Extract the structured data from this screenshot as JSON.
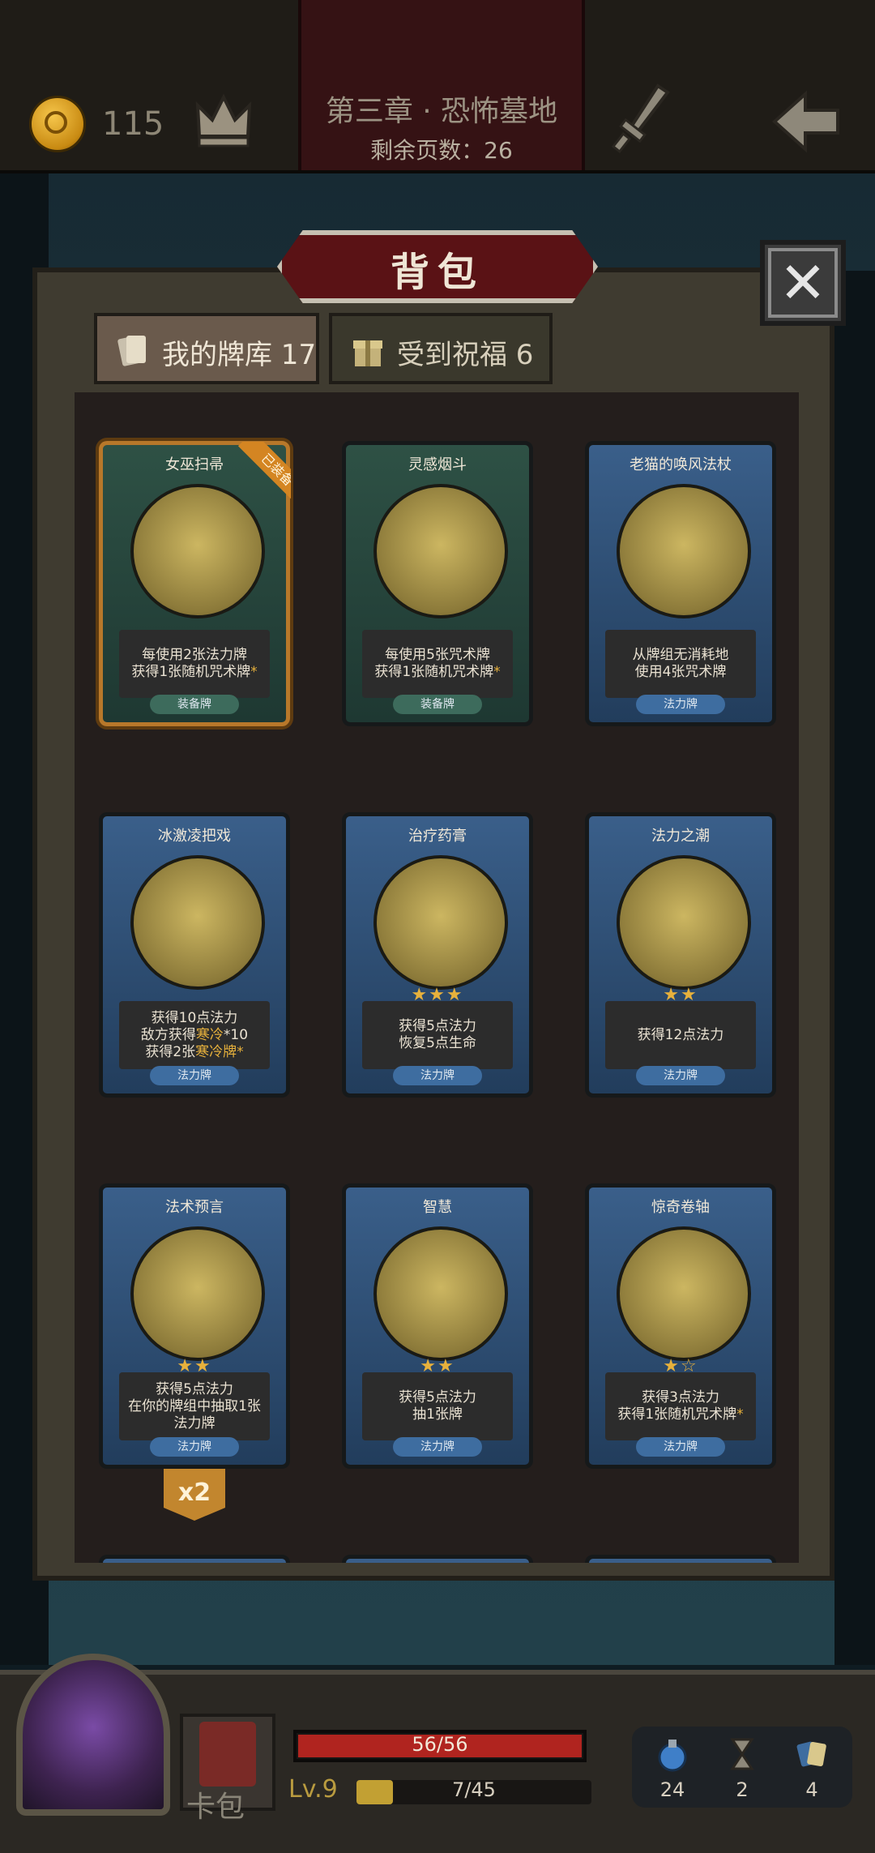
{
  "header": {
    "coins": "115",
    "chapter_title": "第三章 · 恐怖墓地",
    "pages_left": "剩余页数：26"
  },
  "dialog": {
    "title": "背包",
    "tabs": [
      {
        "label": "我的牌库 17"
      },
      {
        "label": "受到祝福 6"
      }
    ]
  },
  "cards": [
    {
      "name": "女巫扫帚",
      "desc1": "每使用2张法力牌",
      "desc2": "获得1张随机咒术牌",
      "desc2_mark": "*",
      "type": "装备牌",
      "badge": "已装备",
      "stars": ""
    },
    {
      "name": "灵感烟斗",
      "desc1": "每使用5张咒术牌",
      "desc2": "获得1张随机咒术牌",
      "desc2_mark": "*",
      "type": "装备牌",
      "stars": ""
    },
    {
      "name": "老猫的唤风法杖",
      "desc1": "从牌组无消耗地",
      "desc2": "使用4张咒术牌",
      "type": "法力牌",
      "stars": ""
    },
    {
      "name": "冰激凌把戏",
      "desc1": "获得10点法力",
      "desc2a": "敌方获得",
      "desc2b": "寒冷",
      "desc2c": "*10",
      "desc3a": "获得2张",
      "desc3b": "寒冷牌",
      "desc3c": "*",
      "type": "法力牌",
      "stars": ""
    },
    {
      "name": "治疗药膏",
      "desc1": "获得5点法力",
      "desc2": "恢复5点生命",
      "type": "法力牌",
      "stars": "★★★"
    },
    {
      "name": "法力之潮",
      "desc1": "获得12点法力",
      "type": "法力牌",
      "stars": "★★"
    },
    {
      "name": "法术预言",
      "desc1": "获得5点法力",
      "desc2": "在你的牌组中抽取1张",
      "desc3": "法力牌",
      "type": "法力牌",
      "stars": "★★"
    },
    {
      "name": "智慧",
      "desc1": "获得5点法力",
      "desc2": "抽1张牌",
      "type": "法力牌",
      "stars": "★★"
    },
    {
      "name": "惊奇卷轴",
      "desc1": "获得3点法力",
      "desc2": "获得1张随机咒术牌",
      "desc2_mark": "*",
      "type": "法力牌",
      "stars": "★☆"
    }
  ],
  "duplicate_badge": "x2",
  "hud": {
    "card_pack_label": "卡包",
    "hp_text": "56/56",
    "hp_fraction": 1.0,
    "level": "Lv.9",
    "xp_text": "7/45",
    "xp_fraction": 0.155,
    "resources": [
      {
        "icon": "potion-icon",
        "value": "24"
      },
      {
        "icon": "hourglass-icon",
        "value": "2"
      },
      {
        "icon": "cards-icon",
        "value": "4"
      }
    ]
  },
  "colors": {
    "accent_gold": "#e7b13c",
    "hp_red": "#b0241f",
    "title_plate": "#5a1215"
  }
}
